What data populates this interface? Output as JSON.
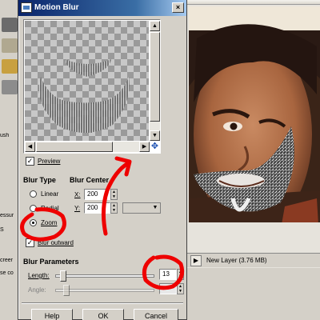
{
  "toolbox": {
    "strip_labels": [
      "ush",
      "essur",
      "S",
      "creer",
      "se co"
    ]
  },
  "dialog": {
    "title": "Motion Blur",
    "close_label": "×",
    "preview_label": "Preview",
    "preview_checked": true,
    "blur_type": {
      "heading": "Blur Type",
      "options": [
        "Linear",
        "Radial",
        "Zoom"
      ],
      "selected": "Zoom"
    },
    "blur_center": {
      "heading": "Blur Center",
      "x_label": "X:",
      "x_value": "200",
      "y_label": "Y:",
      "y_value": "200"
    },
    "blur_outward": {
      "label": "Blur outward",
      "checked": true
    },
    "blur_parameters": {
      "heading": "Blur Parameters",
      "length_label": "Length:",
      "length_value": "13",
      "length_fraction": 0.05,
      "angle_label": "Angle:"
    },
    "buttons": {
      "help": "Help",
      "ok": "OK",
      "cancel": "Cancel"
    }
  },
  "image_window": {
    "status_text": "New Layer (3.76 MB)"
  },
  "colors": {
    "annotation_red": "#ee0000",
    "titlebar_blue": "#0a246a",
    "nav_blue": "#1a4fb0"
  }
}
